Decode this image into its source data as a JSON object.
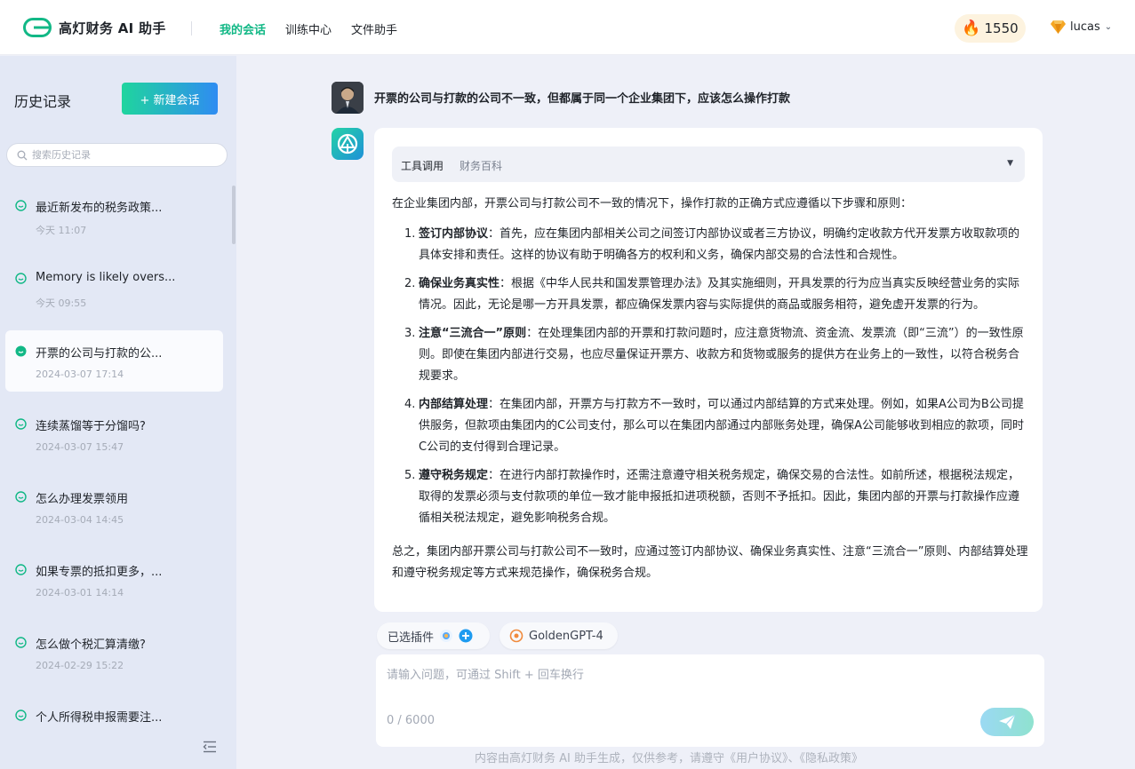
{
  "header": {
    "app_name": "高灯财务 AI 助手",
    "nav": [
      "我的会话",
      "训练中心",
      "文件助手"
    ],
    "points": "1550",
    "user_name": "lucas",
    "user_caret": "⌄",
    "points_icon": "fire-icon",
    "accent_color": "#12b886"
  },
  "sidebar": {
    "title": "历史记录",
    "new_chat_label": "+ 新建会话",
    "search_placeholder": "搜索历史记录",
    "items": [
      {
        "title": "最近新发布的税务政策...",
        "time": "今天 11:07"
      },
      {
        "title": "Memory is likely overs...",
        "time": "今天 09:55"
      },
      {
        "title": "开票的公司与打款的公...",
        "time": "2024-03-07 17:14",
        "active": true
      },
      {
        "title": "连续蒸馏等于分馏吗?",
        "time": "2024-03-07 15:47"
      },
      {
        "title": "怎么办理发票领用",
        "time": "2024-03-04 14:45"
      },
      {
        "title": "如果专票的抵扣更多，...",
        "time": "2024-03-01 14:14"
      },
      {
        "title": "怎么做个税汇算清缴?",
        "time": "2024-02-29 15:22"
      },
      {
        "title": "个人所得税申报需要注...",
        "time": ""
      }
    ]
  },
  "chat": {
    "question": "开票的公司与打款的公司不一致，但都属于同一个企业集团下，应该怎么操作打款",
    "tool_label": "工具调用",
    "tool_value": "财务百科",
    "tool_caret": "▼",
    "intro": "在企业集团内部，开票公司与打款公司不一致的情况下，操作打款的正确方式应遵循以下步骤和原则：",
    "items": [
      {
        "num": "1.",
        "head": "签订内部协议",
        "text": "：首先，应在集团内部相关公司之间签订内部协议或者三方协议，明确约定收款方代开发票方收取款项的具体安排和责任。这样的协议有助于明确各方的权利和义务，确保内部交易的合法性和合规性。"
      },
      {
        "num": "2.",
        "head": "确保业务真实性",
        "text": "：根据《中华人民共和国发票管理办法》及其实施细则，开具发票的行为应当真实反映经营业务的实际情况。因此，无论是哪一方开具发票，都应确保发票内容与实际提供的商品或服务相符，避免虚开发票的行为。"
      },
      {
        "num": "3.",
        "head": "注意“三流合一”原则",
        "text": "：在处理集团内部的开票和打款问题时，应注意货物流、资金流、发票流（即“三流”）的一致性原则。即使在集团内部进行交易，也应尽量保证开票方、收款方和货物或服务的提供方在业务上的一致性，以符合税务合规要求。"
      },
      {
        "num": "4.",
        "head": "内部结算处理",
        "text": "：在集团内部，开票方与打款方不一致时，可以通过内部结算的方式来处理。例如，如果A公司为B公司提供服务，但款项由集团内的C公司支付，那么可以在集团内部通过内部账务处理，确保A公司能够收到相应的款项，同时C公司的支付得到合理记录。"
      },
      {
        "num": "5.",
        "head": "遵守税务规定",
        "text": "：在进行内部打款操作时，还需注意遵守相关税务规定，确保交易的合法性。如前所述，根据税法规定，取得的发票必须与支付款项的单位一致才能申报抵扣进项税额，否则不予抵扣。因此，集团内部的开票与打款操作应遵循相关税法规定，避免影响税务合规。"
      }
    ],
    "summary": "总之，集团内部开票公司与打款公司不一致时，应通过签订内部协议、确保业务真实性、注意“三流合一”原则、内部结算处理和遵守税务规定等方式来规范操作，确保税务合规。"
  },
  "composer": {
    "plugin_label": "已选插件",
    "model_label": "GoldenGPT-4",
    "input_placeholder": "请输入问题，可通过 Shift + 回车换行",
    "char_count": "0 / 6000",
    "footer": "内容由高灯财务 AI 助手生成，仅供参考，请遵守《用户协议》、《隐私政策》"
  }
}
